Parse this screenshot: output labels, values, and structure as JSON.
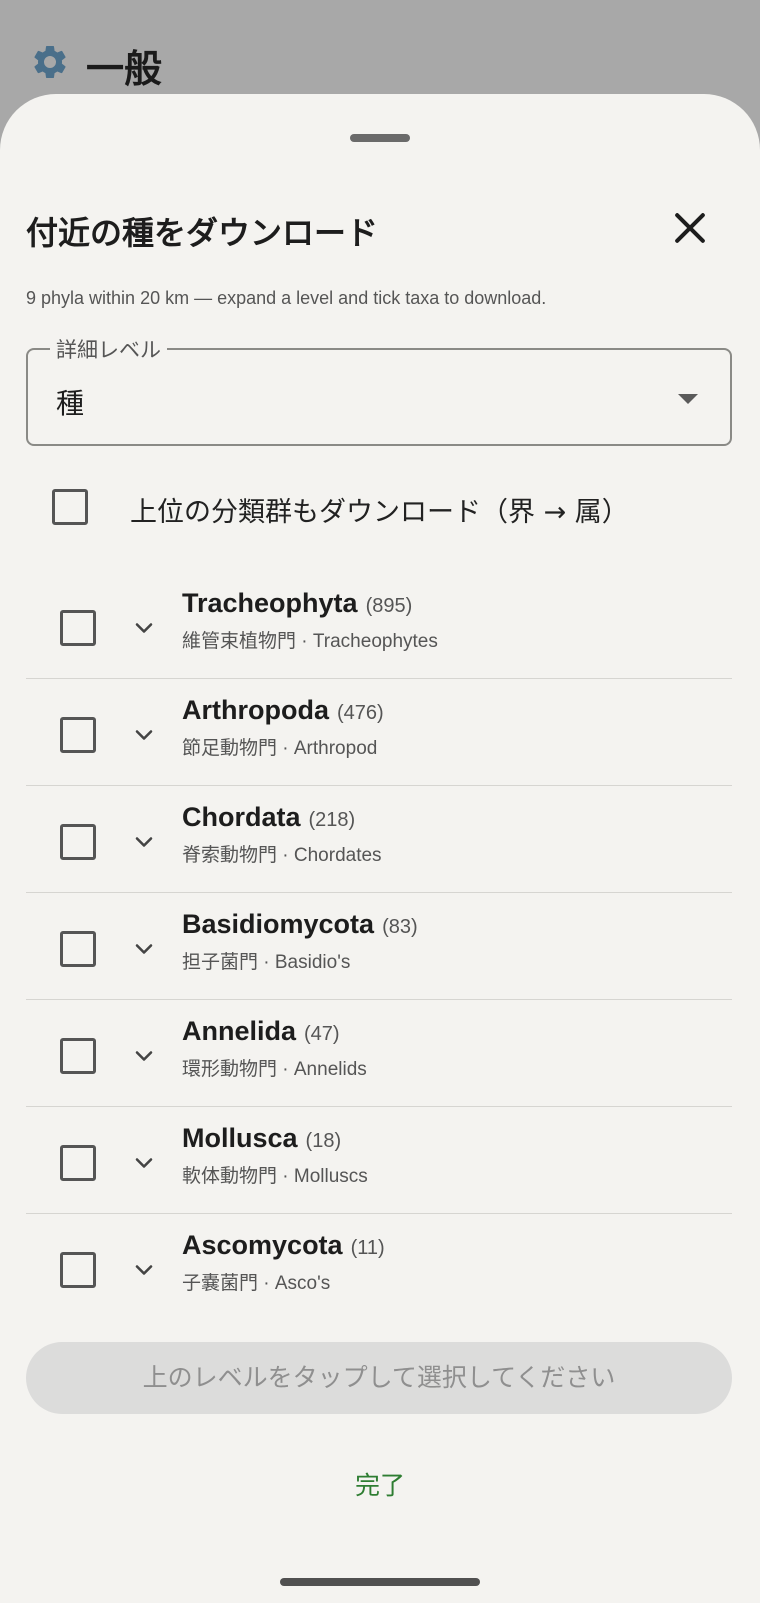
{
  "background": {
    "title": "一般",
    "icon": "gear-icon"
  },
  "sheet": {
    "title": "付近の種をダウンロード",
    "subtitle": "9 phyla within 20 km — expand a level and tick taxa to download.",
    "detail_level": {
      "label": "詳細レベル",
      "value": "種"
    },
    "higher_taxa": {
      "label": "上位の分類群もダウンロード（界 → 属）",
      "checked": false
    },
    "taxa": [
      {
        "name": "Tracheophyta",
        "count": "(895)",
        "common": "維管束植物門 · Tracheophytes",
        "checked": false
      },
      {
        "name": "Arthropoda",
        "count": "(476)",
        "common": "節足動物門 · Arthropod",
        "checked": false
      },
      {
        "name": "Chordata",
        "count": "(218)",
        "common": "脊索動物門 · Chordates",
        "checked": false
      },
      {
        "name": "Basidiomycota",
        "count": "(83)",
        "common": "担子菌門 · Basidio's",
        "checked": false
      },
      {
        "name": "Annelida",
        "count": "(47)",
        "common": "環形動物門 · Annelids",
        "checked": false
      },
      {
        "name": "Mollusca",
        "count": "(18)",
        "common": "軟体動物門 · Molluscs",
        "checked": false
      },
      {
        "name": "Ascomycota",
        "count": "(11)",
        "common": "子嚢菌門 · Asco's",
        "checked": false
      }
    ],
    "action_button": "上のレベルをタップして選択してください",
    "done": "完了"
  },
  "colors": {
    "accent_green": "#2e7d32",
    "gear_blue": "#4a6f8a",
    "sheet_bg": "#f4f3f0",
    "scrim": "#a8a8a8"
  }
}
